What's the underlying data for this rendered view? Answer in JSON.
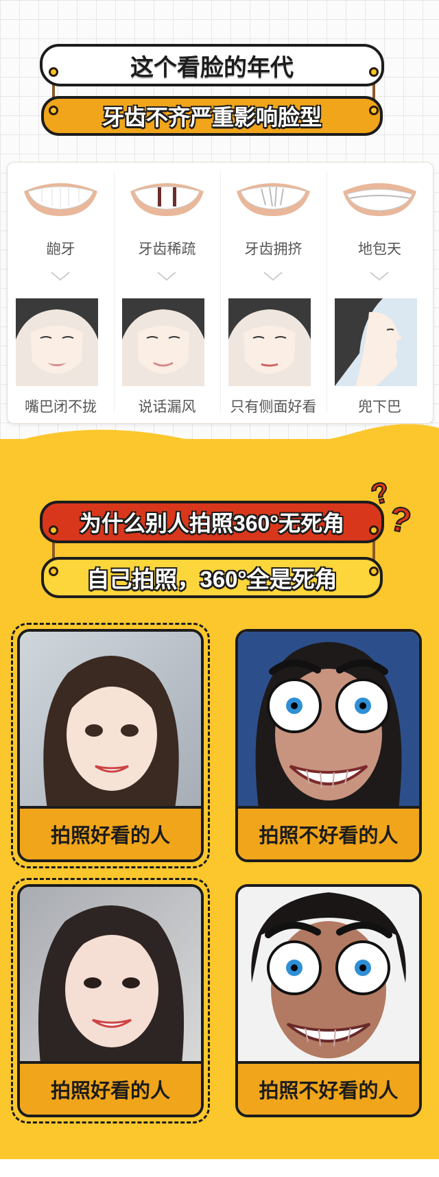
{
  "header": {
    "title": "这个看脸的年代",
    "subtitle": "牙齿不齐严重影响脸型"
  },
  "teeth_types": [
    {
      "label": "龅牙",
      "effect": "嘴巴闭不拢"
    },
    {
      "label": "牙齿稀疏",
      "effect": "说话漏风"
    },
    {
      "label": "牙齿拥挤",
      "effect": "只有侧面好看"
    },
    {
      "label": "地包天",
      "effect": "兜下巴"
    }
  ],
  "section2": {
    "title": "为什么别人拍照360°无死角",
    "subtitle": "自己拍照，360°全是死角"
  },
  "photos": [
    {
      "caption": "拍照好看的人"
    },
    {
      "caption": "拍照不好看的人"
    },
    {
      "caption": "拍照好看的人"
    },
    {
      "caption": "拍照不好看的人"
    }
  ],
  "colors": {
    "gold": "#f0a51b",
    "red": "#d9371b",
    "yellow": "#fcc72d",
    "outline": "#1c1c1c"
  }
}
